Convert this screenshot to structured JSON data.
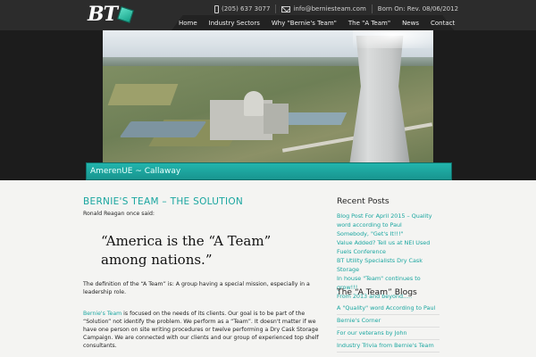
{
  "header": {
    "logo_text": "BT",
    "phone": "(205) 637 3077",
    "email": "info@berniesteam.com",
    "born": "Born On: Rev. 08/06/2012"
  },
  "nav": {
    "items": [
      "Home",
      "Industry Sectors",
      "Why \"Bernie's Team\"",
      "The \"A Team\"",
      "News",
      "Contact"
    ]
  },
  "hero": {
    "caption": "AmerenUE ~ Callaway"
  },
  "main": {
    "title": "BERNIE'S TEAM – THE SOLUTION",
    "intro": "Ronald Reagan once said:",
    "quote_line1": "“America is the “A Team”",
    "quote_line2": "among nations.”",
    "definition": "The definition of the “A Team” is:  A group having a special mission, especially in a leadership role.",
    "p2_link": "Bernie's Team",
    "p2_text": " is focused on the needs of its clients. Our goal is to be part of the “Solution” not identify the problem. We perform as a “Team”. It doesn't matter if we have one person on site writing procedures or twelve performing a Dry Cask Storage Campaign. We are connected with our clients and our group of experienced top shelf consultants."
  },
  "sidebar": {
    "recent_title": "Recent Posts",
    "recent_posts": [
      "Blog Post For April 2015 – Quality word according to Paul",
      "Somebody, \"Get's It!!!\"",
      "Value Added? Tell us at NEI Used Fuels Conference",
      "BT Utility Specialists Dry Cask Storage",
      "In house \"Team\" continues to grow!!!",
      "From 2013 and beyond....."
    ],
    "blogs_title": "The “A Team” Blogs",
    "blogs": [
      "A \"Quality\" word According to Paul",
      "Bernie's Corner",
      "For our veterans by John",
      "Industry Trivia from Bernie's Team"
    ]
  },
  "colors": {
    "accent": "#1aa6a0",
    "header_bg": "#2c2c2c",
    "caption_bg": "#1aa6a0"
  }
}
